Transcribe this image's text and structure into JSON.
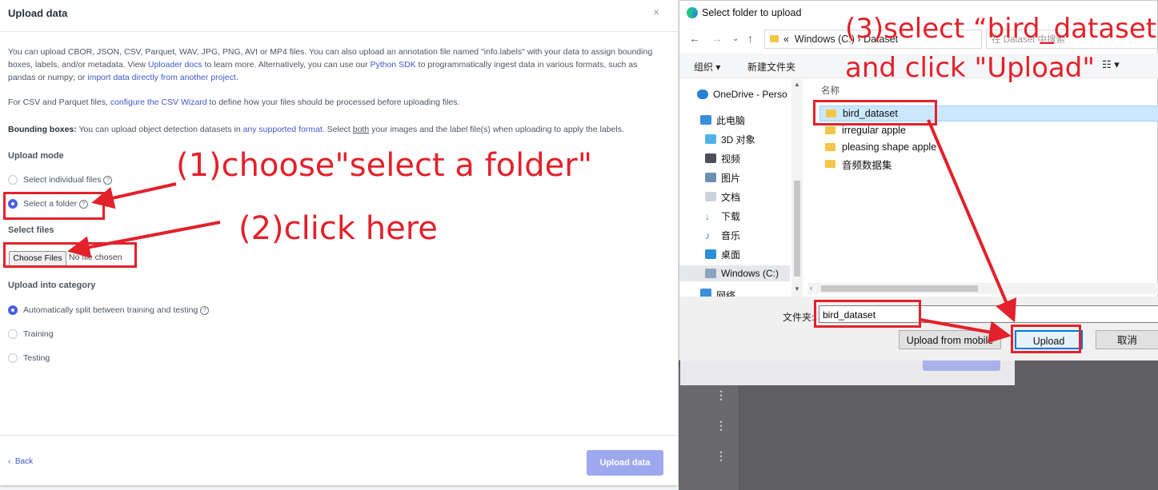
{
  "modal": {
    "title": "Upload data",
    "close": "×",
    "intro": {
      "t1": "You can upload CBOR, JSON, CSV, Parquet, WAV, JPG, PNG, AVI or MP4 files. You can also upload an annotation file named \"info.labels\" with your data to assign bounding boxes, labels, and/or metadata. View ",
      "link1": "Uploader docs",
      "t2": " to learn more. Alternatively, you can use our ",
      "link2": "Python SDK",
      "t3": " to programmatically ingest data in various formats, such as pandas or numpy; or ",
      "link3": "import data directly from another project",
      "t4": "."
    },
    "csv": {
      "t1": "For CSV and Parquet files, ",
      "link": "configure the CSV Wizard",
      "t2": " to define how your files should be processed before uploading files."
    },
    "bbox": {
      "label": "Bounding boxes:",
      "t1": " You can upload object detection datasets in ",
      "link": "any supported format",
      "t2": ". Select ",
      "both": "both",
      "t3": " your images and the label file(s) when uploading to apply the labels."
    },
    "upload_mode": {
      "heading": "Upload mode",
      "options": [
        "Select individual files",
        "Select a folder"
      ],
      "selected": 1
    },
    "select_files": {
      "heading": "Select files",
      "button": "Choose Files",
      "status": "No file chosen"
    },
    "category": {
      "heading": "Upload into category",
      "options": [
        "Automatically split between training and testing",
        "Training",
        "Testing"
      ],
      "selected": 0
    },
    "back": "Back",
    "upload_button": "Upload data"
  },
  "file_dialog": {
    "title": "Select folder to upload",
    "path": [
      "«",
      "Windows (C:)",
      "›",
      "Dataset"
    ],
    "search_placeholder": "在 Dataset 中搜索",
    "organize": "组织 ▾",
    "new_folder": "新建文件夹",
    "nav_items": [
      "OneDrive - Perso",
      "此电脑",
      "3D 对象",
      "视频",
      "图片",
      "文档",
      "下载",
      "音乐",
      "桌面",
      "Windows (C:)",
      "网络"
    ],
    "nav_selected": 9,
    "column_name": "名称",
    "files": [
      "bird_dataset",
      "irregular apple",
      "pleasing shape apple",
      "音频数据集"
    ],
    "selected_file": 0,
    "folder_label": "文件夹:",
    "folder_value": "bird_dataset",
    "buttons": {
      "mobile": "Upload from mobile",
      "upload": "Upload",
      "cancel": "取消"
    }
  },
  "background": {
    "button": "Upload data"
  },
  "annotations": {
    "step1": "(1)choose\"select a folder\"",
    "step2": "(2)click here",
    "step3_line1": "(3)select “bird_dataset”",
    "step3_line2": "and click \"Upload\"",
    "color": "#e3212b"
  }
}
